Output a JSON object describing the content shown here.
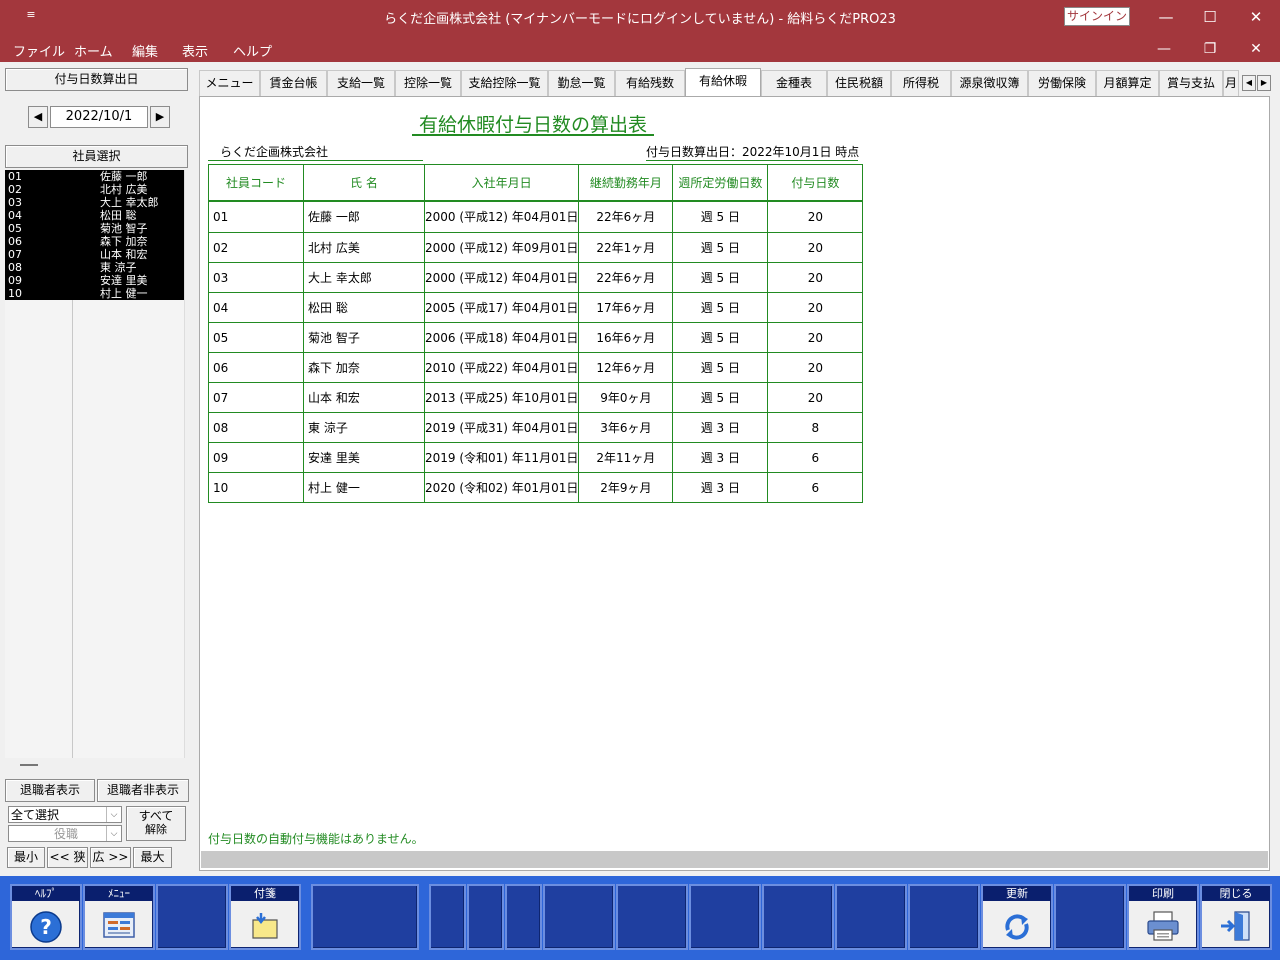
{
  "window": {
    "quick_access": "≡",
    "title": "らくだ企画株式会社 (マイナンバーモードにログインしていません) - 給料らくだPRO23",
    "signin": "サインイン",
    "min": "—",
    "max": "☐",
    "close": "✕"
  },
  "menubar": {
    "items": [
      "ファイル",
      "ホーム",
      "編集",
      "表示",
      "ヘルプ"
    ],
    "min": "—",
    "restore": "❐",
    "close": "✕"
  },
  "left": {
    "calc_date_button": "付与日数算出日",
    "date_value": "2022/10/1",
    "prev_arrow": "◀",
    "next_arrow": "▶",
    "employee_select_button": "社員選択",
    "employees": [
      {
        "code": "01",
        "name": "佐藤 一郎"
      },
      {
        "code": "02",
        "name": "北村 広美"
      },
      {
        "code": "03",
        "name": "大上 幸太郎"
      },
      {
        "code": "04",
        "name": "松田 聡"
      },
      {
        "code": "05",
        "name": "菊池 智子"
      },
      {
        "code": "06",
        "name": "森下 加奈"
      },
      {
        "code": "07",
        "name": "山本 和宏"
      },
      {
        "code": "08",
        "name": "東 涼子"
      },
      {
        "code": "09",
        "name": "安達 里美"
      },
      {
        "code": "10",
        "name": "村上 健一"
      }
    ],
    "show_retired": "退職者表示",
    "hide_retired": "退職者非表示",
    "select_all_value": "全て選択",
    "position_placeholder": "役職",
    "clear_all": "すべて",
    "clear_all_2": "解除",
    "size_min": "最小",
    "size_narrow": "<< 狭",
    "size_wide": "広 >>",
    "size_max": "最大"
  },
  "tabs": [
    {
      "label": "メニュー",
      "active": false
    },
    {
      "label": "賃金台帳",
      "active": false
    },
    {
      "label": "支給一覧",
      "active": false
    },
    {
      "label": "控除一覧",
      "active": false
    },
    {
      "label": "支給控除一覧",
      "active": false
    },
    {
      "label": "勤怠一覧",
      "active": false
    },
    {
      "label": "有給残数",
      "active": false
    },
    {
      "label": "有給休暇",
      "active": true
    },
    {
      "label": "金種表",
      "active": false
    },
    {
      "label": "住民税額",
      "active": false
    },
    {
      "label": "所得税",
      "active": false
    },
    {
      "label": "源泉徴収簿",
      "active": false
    },
    {
      "label": "労働保険",
      "active": false
    },
    {
      "label": "月額算定",
      "active": false
    },
    {
      "label": "賞与支払",
      "active": false
    },
    {
      "label": "月",
      "active": false
    }
  ],
  "tab_scroll": {
    "left": "◀",
    "right": "▶"
  },
  "report": {
    "title": "有給休暇付与日数の算出表",
    "company": "らくだ企画株式会社",
    "calc_date_label": "付与日数算出日：2022年10月1日 時点",
    "columns": [
      "社員コード",
      "氏 名",
      "入社年月日",
      "継続勤務年月",
      "週所定労働日数",
      "付与日数"
    ],
    "rows": [
      {
        "code": "01",
        "name": "佐藤 一郎",
        "hire": "2000 (平成12) 年04月01日",
        "tenure": "22年6ヶ月",
        "days_per_week": "週 5 日",
        "grant": "20"
      },
      {
        "code": "02",
        "name": "北村 広美",
        "hire": "2000 (平成12) 年09月01日",
        "tenure": "22年1ヶ月",
        "days_per_week": "週 5 日",
        "grant": "20"
      },
      {
        "code": "03",
        "name": "大上 幸太郎",
        "hire": "2000 (平成12) 年04月01日",
        "tenure": "22年6ヶ月",
        "days_per_week": "週 5 日",
        "grant": "20"
      },
      {
        "code": "04",
        "name": "松田 聡",
        "hire": "2005 (平成17) 年04月01日",
        "tenure": "17年6ヶ月",
        "days_per_week": "週 5 日",
        "grant": "20"
      },
      {
        "code": "05",
        "name": "菊池 智子",
        "hire": "2006 (平成18) 年04月01日",
        "tenure": "16年6ヶ月",
        "days_per_week": "週 5 日",
        "grant": "20"
      },
      {
        "code": "06",
        "name": "森下 加奈",
        "hire": "2010 (平成22) 年04月01日",
        "tenure": "12年6ヶ月",
        "days_per_week": "週 5 日",
        "grant": "20"
      },
      {
        "code": "07",
        "name": "山本 和宏",
        "hire": "2013 (平成25) 年10月01日",
        "tenure": "9年0ヶ月",
        "days_per_week": "週 5 日",
        "grant": "20"
      },
      {
        "code": "08",
        "name": "東 涼子",
        "hire": "2019 (平成31) 年04月01日",
        "tenure": "3年6ヶ月",
        "days_per_week": "週 3 日",
        "grant": "8"
      },
      {
        "code": "09",
        "name": "安達 里美",
        "hire": "2019 (令和01) 年11月01日",
        "tenure": "2年11ヶ月",
        "days_per_week": "週 3 日",
        "grant": "6"
      },
      {
        "code": "10",
        "name": "村上 健一",
        "hire": "2020 (令和02) 年01月01日",
        "tenure": "2年9ヶ月",
        "days_per_week": "週 3 日",
        "grant": "6"
      }
    ],
    "note": "付与日数の自動付与機能はありません。"
  },
  "toolbar": {
    "help": "ﾍﾙﾌﾟ",
    "menu": "ﾒﾆｭｰ",
    "sticky": "付箋",
    "refresh": "更新",
    "print": "印刷",
    "close": "閉じる"
  },
  "colors": {
    "titlebar": "#a3373d",
    "report_green": "#228b22",
    "toolbar_blue": "#2e66d9",
    "fkey_dark": "#1f3fa0"
  }
}
